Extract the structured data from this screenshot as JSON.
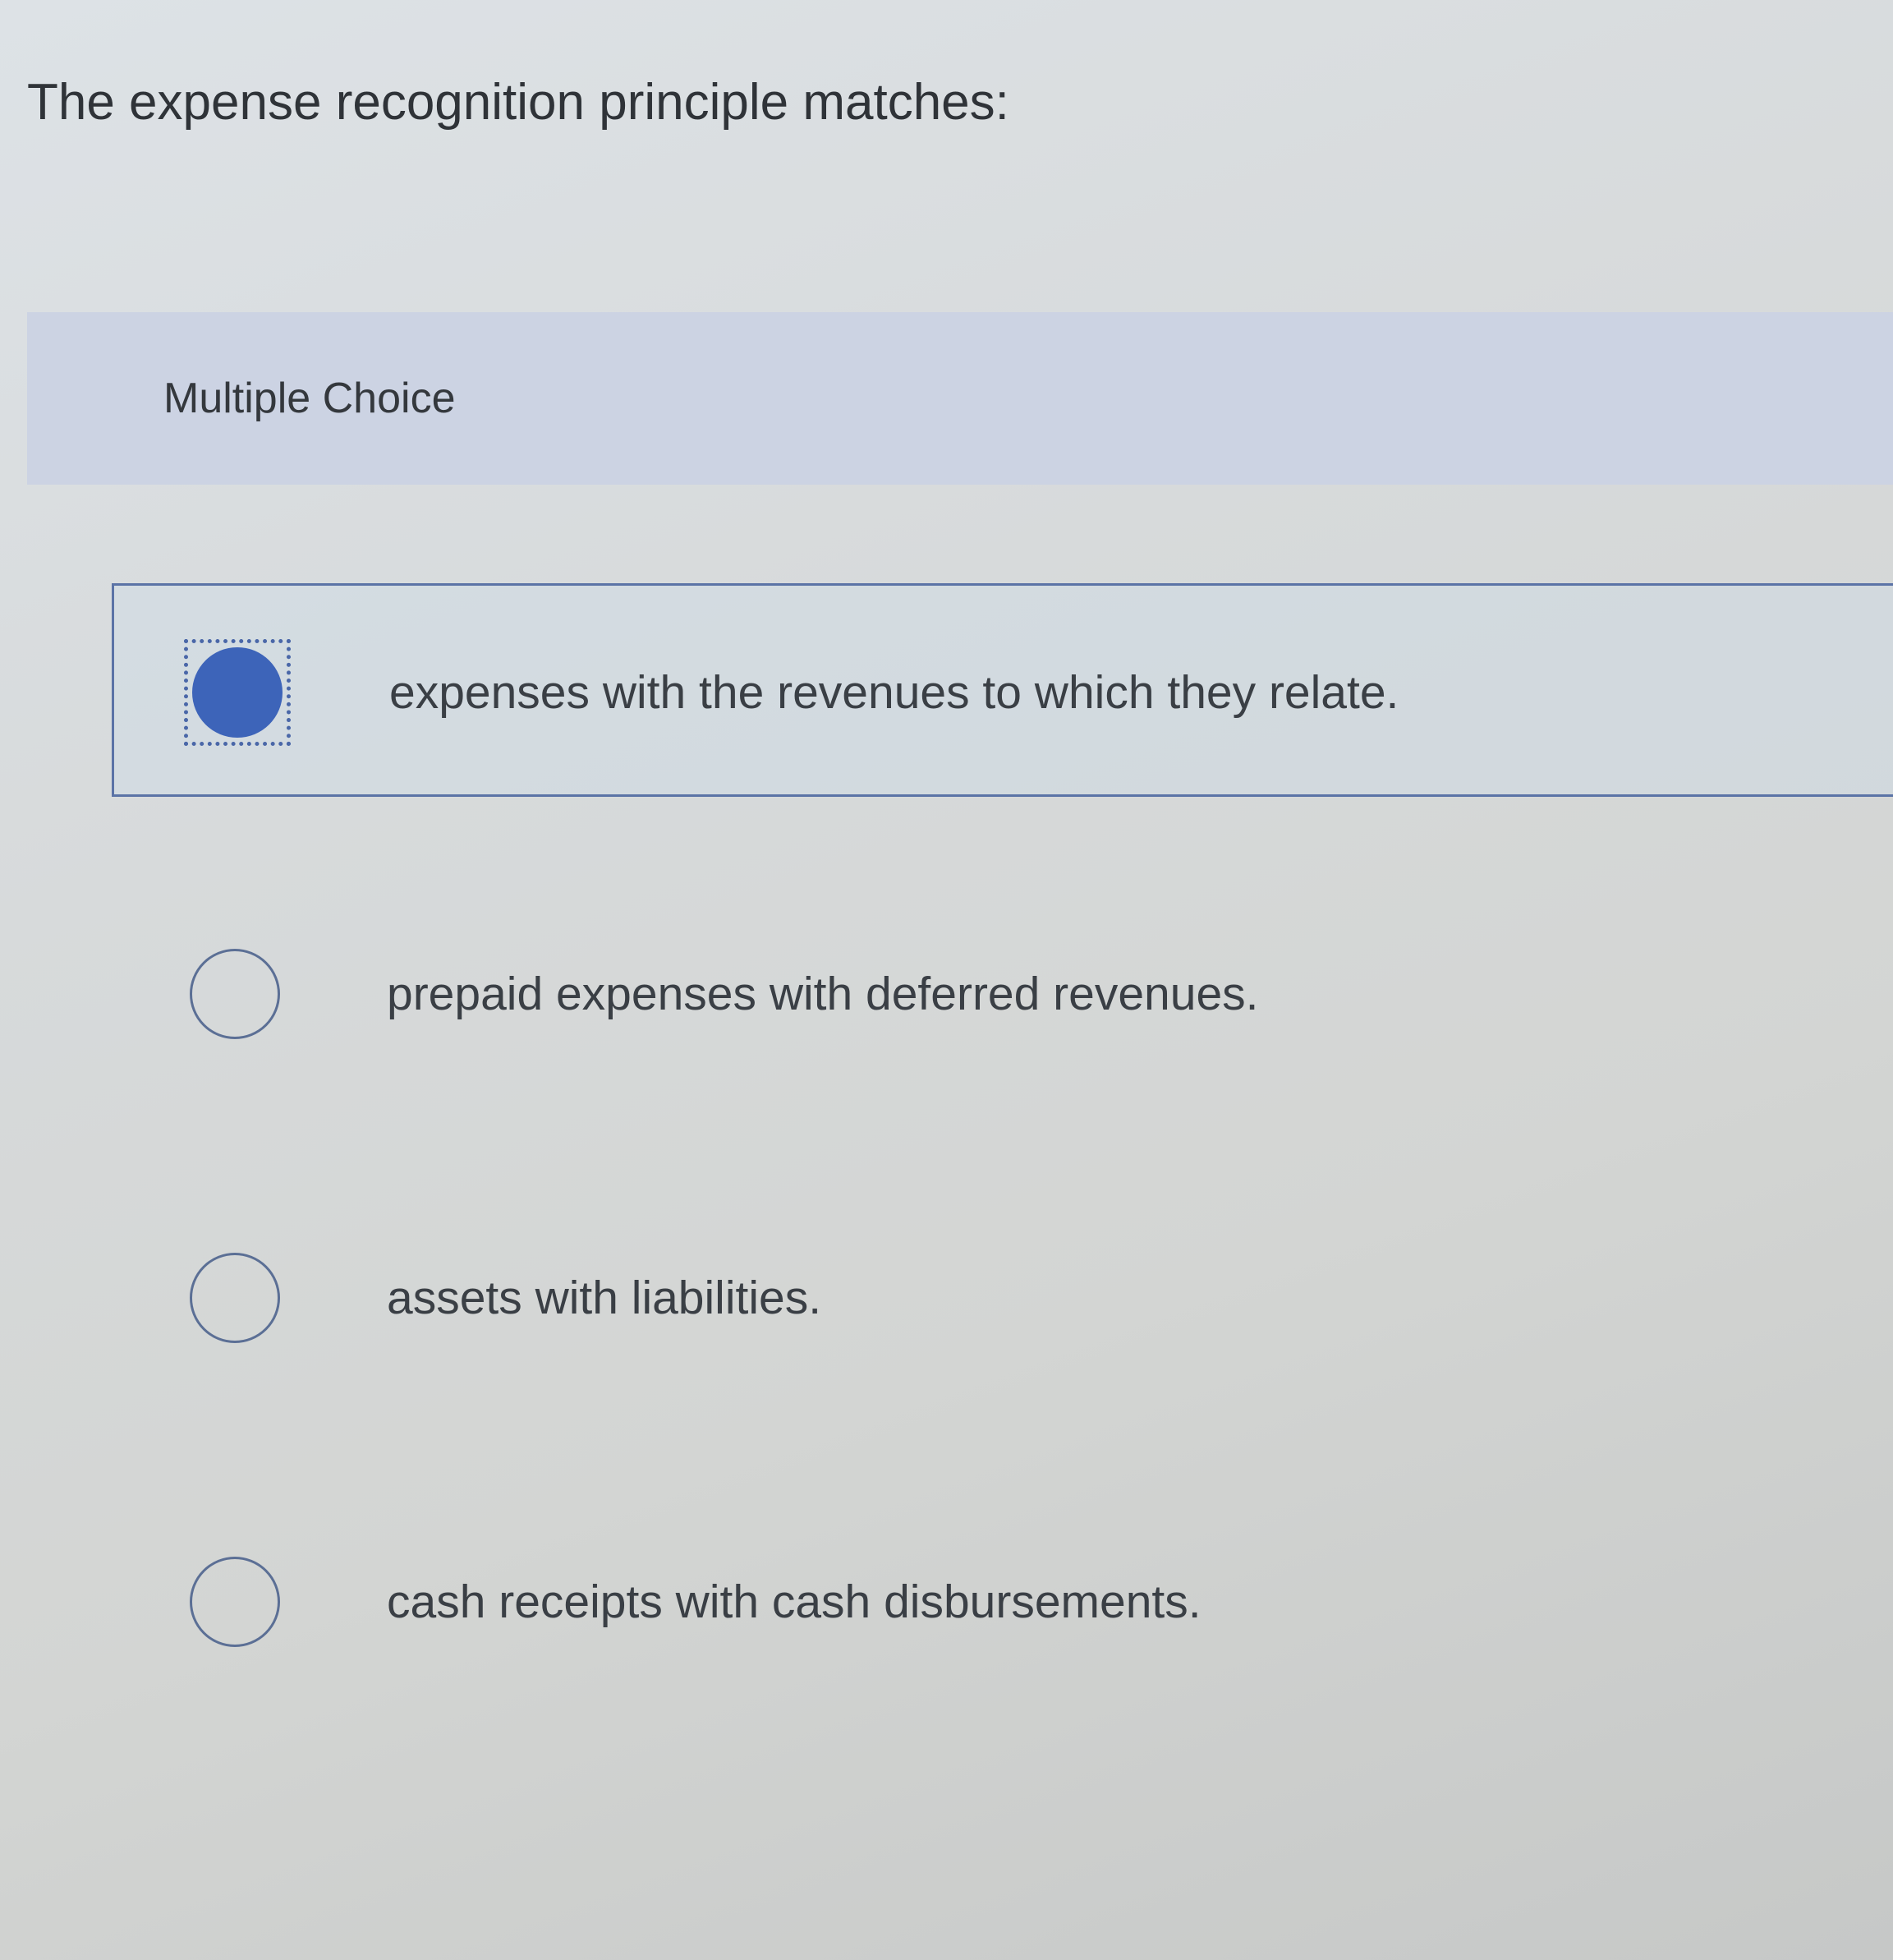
{
  "question": {
    "text": "The expense recognition principle matches:"
  },
  "section": {
    "label": "Multiple Choice"
  },
  "options": [
    {
      "label": "expenses with the revenues to which they relate.",
      "selected": true
    },
    {
      "label": "prepaid expenses with deferred revenues.",
      "selected": false
    },
    {
      "label": "assets with liabilities.",
      "selected": false
    },
    {
      "label": "cash receipts with cash disbursements.",
      "selected": false
    }
  ],
  "colors": {
    "accent": "#3d64b9",
    "header_bg": "#ccd3e3",
    "selected_border": "#5b73a6"
  }
}
